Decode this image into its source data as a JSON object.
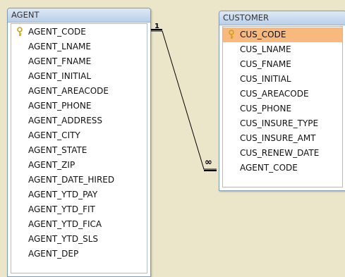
{
  "agent_table": {
    "title": "AGENT",
    "fields": [
      {
        "name": "AGENT_CODE",
        "primary_key": true
      },
      {
        "name": "AGENT_LNAME"
      },
      {
        "name": "AGENT_FNAME"
      },
      {
        "name": "AGENT_INITIAL"
      },
      {
        "name": "AGENT_AREACODE"
      },
      {
        "name": "AGENT_PHONE"
      },
      {
        "name": "AGENT_ADDRESS"
      },
      {
        "name": "AGENT_CITY"
      },
      {
        "name": "AGENT_STATE"
      },
      {
        "name": "AGENT_ZIP"
      },
      {
        "name": "AGENT_DATE_HIRED"
      },
      {
        "name": "AGENT_YTD_PAY"
      },
      {
        "name": "AGENT_YTD_FIT"
      },
      {
        "name": "AGENT_YTD_FICA"
      },
      {
        "name": "AGENT_YTD_SLS"
      },
      {
        "name": "AGENT_DEP"
      }
    ]
  },
  "customer_table": {
    "title": "CUSTOMER",
    "fields": [
      {
        "name": "CUS_CODE",
        "primary_key": true,
        "selected": true
      },
      {
        "name": "CUS_LNAME"
      },
      {
        "name": "CUS_FNAME"
      },
      {
        "name": "CUS_INITIAL"
      },
      {
        "name": "CUS_AREACODE"
      },
      {
        "name": "CUS_PHONE"
      },
      {
        "name": "CUS_INSURE_TYPE"
      },
      {
        "name": "CUS_INSURE_AMT"
      },
      {
        "name": "CUS_RENEW_DATE"
      },
      {
        "name": "AGENT_CODE"
      }
    ]
  },
  "relationship": {
    "from_label": "1",
    "to_label": "∞"
  },
  "colors": {
    "background": "#ebe5c9",
    "selected_row": "#f7b97e",
    "title_bar": "#c6d8ee",
    "key_icon": "#d4a017"
  },
  "icons": {
    "primary_key": "key-icon"
  }
}
